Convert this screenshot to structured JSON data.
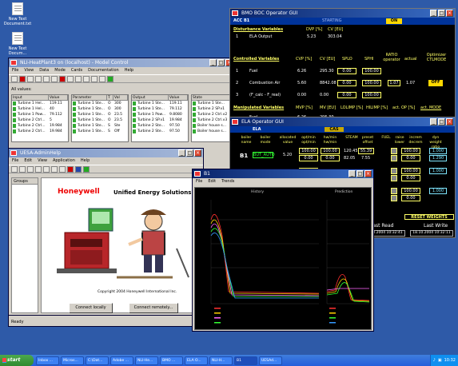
{
  "desktop": {
    "icons": [
      {
        "label": "New Text Document.txt"
      },
      {
        "label": "New Text Docum..."
      }
    ]
  },
  "model_control": {
    "title": "NLI-HeatPlant3 on (localhost) - Model Control",
    "menu": [
      "File",
      "View",
      "Data",
      "Mode",
      "Cards",
      "Documentation",
      "Help"
    ],
    "all_values_label": "All values:",
    "input_grid": {
      "headers": [
        "Input",
        "Value"
      ],
      "rows": [
        [
          "Turbine 1 Hel...",
          "119.11"
        ],
        [
          "Turbine 1 Hel...",
          "40"
        ],
        [
          "Turbine 1 Pow...",
          "79.112"
        ],
        [
          "Turbine 2 Ctrl...",
          "5"
        ],
        [
          "Turbine 2 Ctrl...",
          "19.984"
        ],
        [
          "Turbine 2 Ctrl...",
          "19.984"
        ]
      ]
    },
    "param_grid": {
      "headers": [
        "Parameter",
        "T",
        "Val"
      ],
      "rows": [
        [
          "Turbine 1 Ste...",
          "O",
          "300"
        ],
        [
          "Turbine 1 Ste...",
          "O",
          "300"
        ],
        [
          "Turbine 1 Ste...",
          "O",
          "23.5"
        ],
        [
          "Turbine 1 Ste...",
          "O",
          "23.5"
        ],
        [
          "Turbine 1 Ste...",
          "S",
          "Ste"
        ],
        [
          "Turbine 1 Ste...",
          "S",
          "Off"
        ]
      ]
    },
    "output_grid": {
      "headers": [
        "Output",
        "Value"
      ],
      "rows": [
        [
          "Turbine 1 Ste...",
          "119.11"
        ],
        [
          "Turbine 1 Ste...",
          "79.112"
        ],
        [
          "Turbine 1 Pow...",
          "9.8080"
        ],
        [
          "Turbine 2 SP.v1",
          "19.984"
        ],
        [
          "Turbine 2 Ste...",
          "97.50"
        ],
        [
          "Turbine 2 Ste...",
          "97.50"
        ]
      ]
    },
    "state_grid": {
      "headers": [
        "State"
      ],
      "rows": [
        [
          "Turbine 1 Ste..."
        ],
        [
          "Turbine 2 SP.v1"
        ],
        [
          "Turbine 2 Ctrl.v2"
        ],
        [
          "Turbine 2 Ctrl.v3"
        ],
        [
          "Boiler house s..."
        ],
        [
          "Boiler house s..."
        ]
      ]
    },
    "status": "Ready"
  },
  "boc_gui": {
    "title": "BMO BOC Operator GUI",
    "header": {
      "tag": "ACC B1",
      "status1": "STARTING",
      "status2": "ON"
    },
    "disturbance": {
      "section_title": "Disturbance Variables",
      "col_dvp": "DVP [%]",
      "col_cv": "CV [EU]",
      "row_num": "1",
      "row_name": "ELA Output",
      "row_dvp": "5.23",
      "row_cv": "303.04"
    },
    "controlled": {
      "section_title": "Controlled Variables",
      "col_cvp": "CVP [%]",
      "col_cv": "CV [EU]",
      "col_splo": "SPLO",
      "col_sphi": "SPHI",
      "col_ratio": "RATIO operator",
      "col_actual": "actual",
      "col_optimizer": "Optimizer CTLMODE",
      "rows": [
        {
          "num": "1",
          "name": "Fuel",
          "cvp": "6.26",
          "cv": "295.30",
          "splo": "0.00",
          "sphi": "100.00",
          "ratio": "",
          "actual": "",
          "mode": ""
        },
        {
          "num": "2",
          "name": "Combustion Air",
          "cvp": "5.60",
          "cv": "8842.08",
          "splo": "0.00",
          "sphi": "100.00",
          "ratio": "1.07",
          "actual": "1.07",
          "mode": "OFF"
        },
        {
          "num": "3",
          "name": "(F_calc - F_real)",
          "cvp": "0.00",
          "cv": "0.00",
          "splo": "0.00",
          "sphi": "100.00",
          "ratio": "",
          "actual": "",
          "mode": ""
        }
      ]
    },
    "manipulated": {
      "section_title": "Manipulated Variables",
      "col_mvp": "MVP [%]",
      "col_mv": "MV [EU]",
      "col_lolmp": "LOLIMP [%]",
      "col_hilmp": "HILIMP [%]",
      "col_act_op": "act. OP [%]",
      "col_act_mode": "act. MODE",
      "row_name": "Fuel",
      "row_mvp": "6.26",
      "row_mv": "295.30"
    }
  },
  "ela_gui": {
    "title": "ELA Operator GUI",
    "header": {
      "tag": "ELA",
      "status": "CAS"
    },
    "columns": [
      "boiler name",
      "boiler mode",
      "allocated value",
      "opt/min opt/min",
      "hw/min hw/min",
      "STEAM",
      "preset offset",
      "FUEL",
      "raise lower",
      "increm decrem",
      "dyn weight ratio"
    ],
    "rows": [
      {
        "name": "B1",
        "mode": "BUT_AUTO",
        "allocated": "5.20",
        "optmin": "100.00",
        "optmin2": "0.00",
        "hwmin": "100.00",
        "hwmin2": "0.00",
        "steam": "120.45",
        "steam2": "82.05",
        "preset": "55.39",
        "preset2": "7.55",
        "incr": "100.00",
        "decr": "0.00",
        "dyn": "1.000",
        "ratio": "1.290"
      },
      {
        "name": "",
        "mode": "",
        "allocated": "",
        "optmin": "100.00",
        "optmin2": "0.00",
        "hwmin": "",
        "hwmin2": "",
        "steam": "",
        "steam2": "",
        "preset": "",
        "preset2": "",
        "incr": "100.00",
        "decr": "0.00",
        "dyn": "1.000",
        "ratio": ""
      },
      {
        "name": "",
        "mode": "",
        "allocated": "",
        "optmin": "100.00",
        "optmin2": "0.00",
        "hwmin": "",
        "hwmin2": "",
        "steam": "",
        "steam2": "",
        "preset": "",
        "preset2": "",
        "incr": "100.00",
        "decr": "0.00",
        "dyn": "1.000",
        "ratio": ""
      }
    ],
    "reset_label": "RESET WEIGHTS",
    "last_read_label": "Last Read",
    "last_write_label": "Last Write",
    "last_read_value": "18.10.2004 10:32:41",
    "last_write_value": "18.10.2004 10:32:11"
  },
  "uesa": {
    "title": "UESA-AdminHelp",
    "menu": [
      "File",
      "Edit",
      "View",
      "Application",
      "Help"
    ],
    "groups_label": "Groups",
    "logo": "Honeywell",
    "tagline": "Unified Energy Solutions",
    "copyright": "Copyright 2004 Honeywell International Inc.",
    "connect_local": "Connect locally",
    "connect_remote": "Connect remotely..."
  },
  "trend": {
    "title": "B1",
    "menu": [
      "File",
      "Edit",
      "Trends"
    ],
    "history_label": "History",
    "prediction_label": "Prediction"
  },
  "taskbar": {
    "start": "start",
    "tasks": [
      "Inbox ...",
      "Micros...",
      "C:\\Dat...",
      "Adobe ...",
      "NLI-He...",
      "BMO ...",
      "ELA O...",
      "NLI-H...",
      "B1",
      "UESAd..."
    ],
    "clock": "10:32"
  }
}
